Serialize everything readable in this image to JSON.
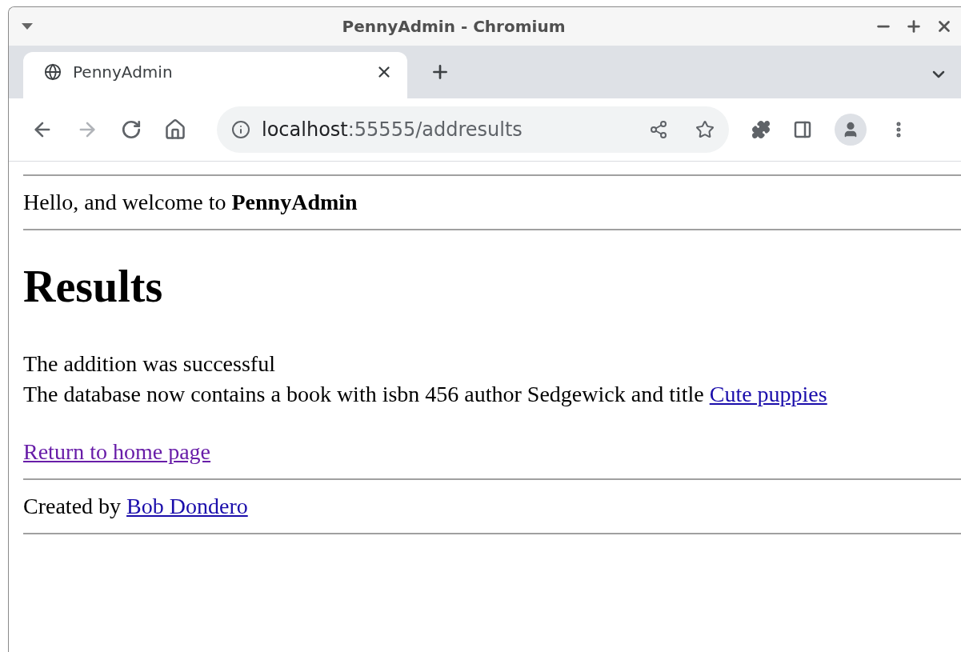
{
  "window": {
    "title": "PennyAdmin - Chromium"
  },
  "tabs": [
    {
      "label": "PennyAdmin",
      "selected": true
    }
  ],
  "address_bar": {
    "host": "localhost",
    "path": ":55555/addresults"
  },
  "page": {
    "greeting": "Hello, and welcome to **PennyAdmin**",
    "heading": "Results",
    "lines": [
      {
        "text": "The addition was successful"
      },
      {
        "text": "The database now contains a book with isbn 456 author Sedgewick and title",
        "link": {
          "label": "Cute puppies",
          "visited": false
        }
      }
    ],
    "return_link": {
      "label": "Return to home page",
      "visited": true
    },
    "footer": {
      "text": "Created by",
      "link": {
        "label": "Bob Dondero",
        "visited": false
      }
    }
  }
}
